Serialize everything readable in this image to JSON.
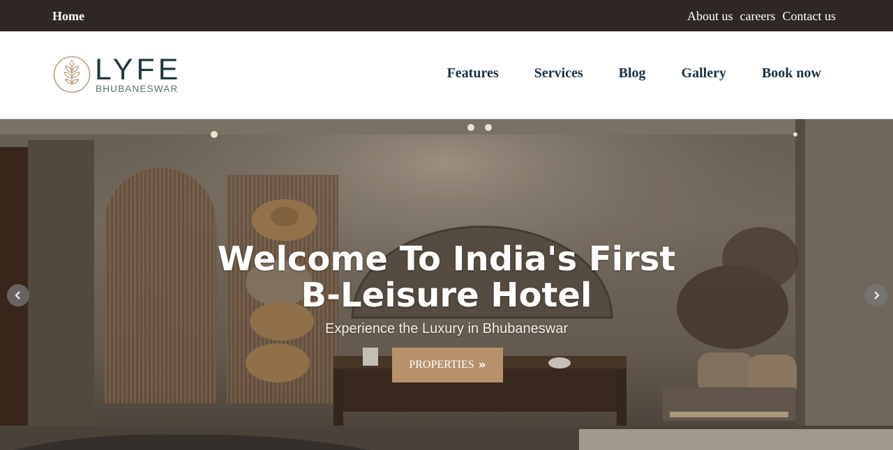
{
  "topbar": {
    "home": "Home",
    "links": [
      "About us",
      "careers",
      "Contact us"
    ]
  },
  "logo": {
    "wordmark": "LYFE",
    "subtext": "BHUBANESWAR",
    "icon": "leaf-emblem-icon"
  },
  "nav": {
    "items": [
      "Features",
      "Services",
      "Blog",
      "Gallery",
      "Book now"
    ]
  },
  "hero": {
    "title_line1": "Welcome To India's First",
    "title_line2": "B-Leisure Hotel",
    "subtitle": "Experience the Luxury in Bhubaneswar",
    "cta_label": "PROPERTIES",
    "cta_icon": "double-chevron-right-icon",
    "prev_icon": "chevron-left-icon",
    "next_icon": "chevron-right-icon"
  },
  "colors": {
    "topbar_bg": "#2f2724",
    "nav_text": "#1b3047",
    "logo_text": "#1e3a3c",
    "cta_bg": "#b7916b"
  }
}
